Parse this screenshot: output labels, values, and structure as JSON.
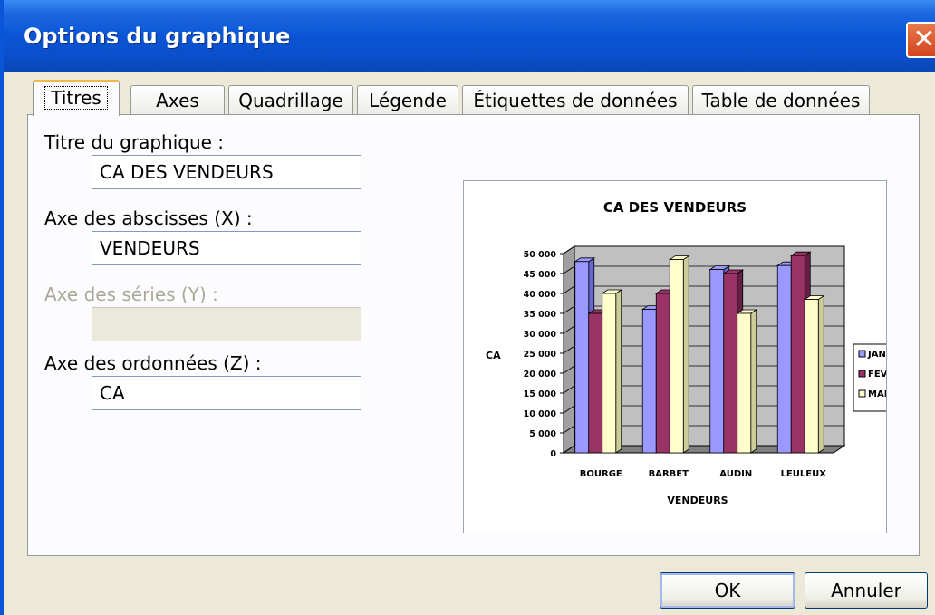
{
  "window": {
    "title": "Options du graphique",
    "close_glyph": "✕"
  },
  "tabs": [
    {
      "label": "Titres",
      "active": true
    },
    {
      "label": "Axes"
    },
    {
      "label": "Quadrillage"
    },
    {
      "label": "Légende"
    },
    {
      "label": "Étiquettes de données"
    },
    {
      "label": "Table de données"
    }
  ],
  "form": {
    "chart_title": {
      "label": "Titre du graphique :",
      "value": "CA DES VENDEURS"
    },
    "x_axis": {
      "label": "Axe des abscisses (X) :",
      "value": "VENDEURS"
    },
    "y_axis": {
      "label": "Axe des séries (Y) :",
      "value": "",
      "disabled": true
    },
    "z_axis": {
      "label": "Axe des ordonnées (Z) :",
      "value": "CA"
    }
  },
  "buttons": {
    "ok": "OK",
    "cancel": "Annuler"
  },
  "colors": {
    "janvier": "#9999ff",
    "fevrier": "#993366",
    "mars": "#ffffcc",
    "wall": "#c0c0c0"
  },
  "chart_data": {
    "type": "bar",
    "title": "CA DES VENDEURS",
    "xlabel": "VENDEURS",
    "ylabel": "CA",
    "categories": [
      "BOURGE",
      "BARBET",
      "AUDIN",
      "LEULEUX"
    ],
    "series": [
      {
        "name": "JANVIER",
        "values": [
          48000,
          36000,
          46000,
          47000
        ]
      },
      {
        "name": "FEVRIER",
        "values": [
          35000,
          40000,
          45000,
          49500
        ]
      },
      {
        "name": "MARS",
        "values": [
          40000,
          48500,
          35000,
          38500
        ]
      }
    ],
    "yticks": [
      "0",
      "5 000",
      "10 000",
      "15 000",
      "20 000",
      "25 000",
      "30 000",
      "35 000",
      "40 000",
      "45 000",
      "50 000"
    ],
    "ylim": [
      0,
      50000
    ],
    "legend": "right",
    "grid": true
  }
}
